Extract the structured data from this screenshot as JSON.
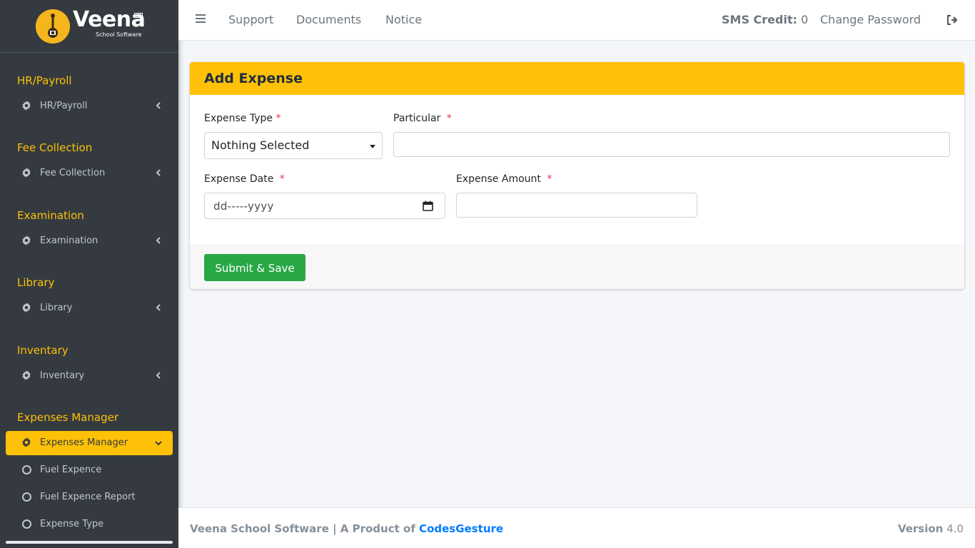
{
  "brand": {
    "name": "Veena",
    "tagline": "School Software",
    "badge": "TM"
  },
  "sidebar": {
    "sections": [
      {
        "header": "HR/Payroll",
        "item": "HR/Payroll"
      },
      {
        "header": "Fee Collection",
        "item": "Fee Collection"
      },
      {
        "header": "Examination",
        "item": "Examination"
      },
      {
        "header": "Library",
        "item": "Library"
      },
      {
        "header": "Inventary",
        "item": "Inventary"
      },
      {
        "header": "Expenses Manager",
        "item": "Expenses Manager"
      }
    ],
    "subitems": [
      "Fuel Expence",
      "Fuel Expence Report",
      "Expense Type"
    ]
  },
  "topbar": {
    "links": [
      "Support",
      "Documents",
      "Notice"
    ],
    "sms_label": "SMS Credit:",
    "sms_value": "0",
    "change_password": "Change Password"
  },
  "form": {
    "title": "Add Expense",
    "expense_type_label": "Expense Type",
    "expense_type_value": "Nothing Selected",
    "particular_label": "Particular",
    "expense_date_label": "Expense Date",
    "expense_date_placeholder": "dd-----yyyy",
    "expense_amount_label": "Expense Amount",
    "required_mark": "*",
    "submit_label": "Submit & Save"
  },
  "footer": {
    "text": "Veena School Software | A Product of",
    "brand_link": "CodesGesture",
    "version_label": "Version",
    "version_value": "4.0"
  },
  "colors": {
    "accent": "#ffc107",
    "sidebar": "#343a40",
    "success": "#28a745",
    "link": "#007bff"
  }
}
